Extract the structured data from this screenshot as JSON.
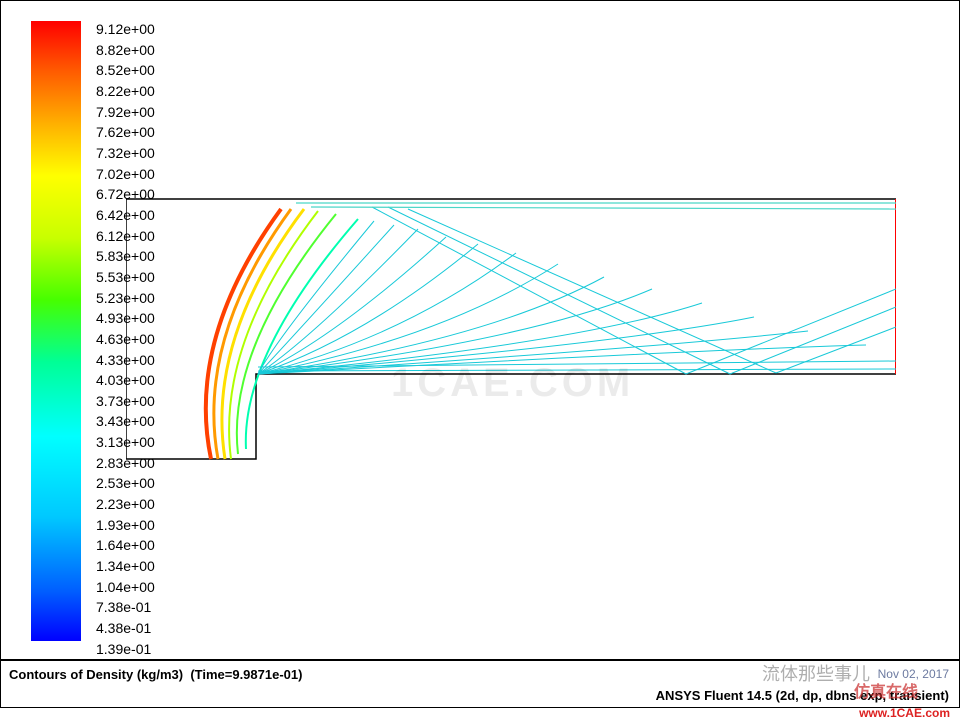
{
  "software": "ANSYS Fluent",
  "version": "14.5",
  "solver_info": "(2d, dp, dbns exp, transient)",
  "date_text": "Nov 02, 2017",
  "title": "Contours of Density (kg/m3)",
  "time_text": "(Time=9.9871e-01)",
  "quantity": "Density",
  "units": "kg/m3",
  "time_value": 0.99871,
  "legend": {
    "ticks": [
      "9.12e+00",
      "8.82e+00",
      "8.52e+00",
      "8.22e+00",
      "7.92e+00",
      "7.62e+00",
      "7.32e+00",
      "7.02e+00",
      "6.72e+00",
      "6.42e+00",
      "6.12e+00",
      "5.83e+00",
      "5.53e+00",
      "5.23e+00",
      "4.93e+00",
      "4.63e+00",
      "4.33e+00",
      "4.03e+00",
      "3.73e+00",
      "3.43e+00",
      "3.13e+00",
      "2.83e+00",
      "2.53e+00",
      "2.23e+00",
      "1.93e+00",
      "1.64e+00",
      "1.34e+00",
      "1.04e+00",
      "7.38e-01",
      "4.38e-01",
      "1.39e-01"
    ],
    "min": 0.139,
    "max": 9.12
  },
  "colormap_stops": [
    {
      "p": 0.0,
      "c": "#0000ff"
    },
    {
      "p": 0.08,
      "c": "#005eff"
    },
    {
      "p": 0.2,
      "c": "#00c8ff"
    },
    {
      "p": 0.33,
      "c": "#00ffff"
    },
    {
      "p": 0.45,
      "c": "#00ff96"
    },
    {
      "p": 0.55,
      "c": "#46ff00"
    },
    {
      "p": 0.65,
      "c": "#c8ff00"
    },
    {
      "p": 0.75,
      "c": "#ffff00"
    },
    {
      "p": 0.83,
      "c": "#ffb400"
    },
    {
      "p": 0.92,
      "c": "#ff5a00"
    },
    {
      "p": 1.0,
      "c": "#ff0000"
    }
  ],
  "geometry_description": "2D stepped channel: rectangular domain with a forward-facing step on the lower-left. Bow-shock density contours emanate from the step corner and reflect off the top wall; expansion fan and oblique shock structures downstream.",
  "watermarks": {
    "center": "1CAE.COM",
    "wechat": "流体那些事儿",
    "red_text": "仿真在线",
    "site": "www.1CAE.com"
  }
}
